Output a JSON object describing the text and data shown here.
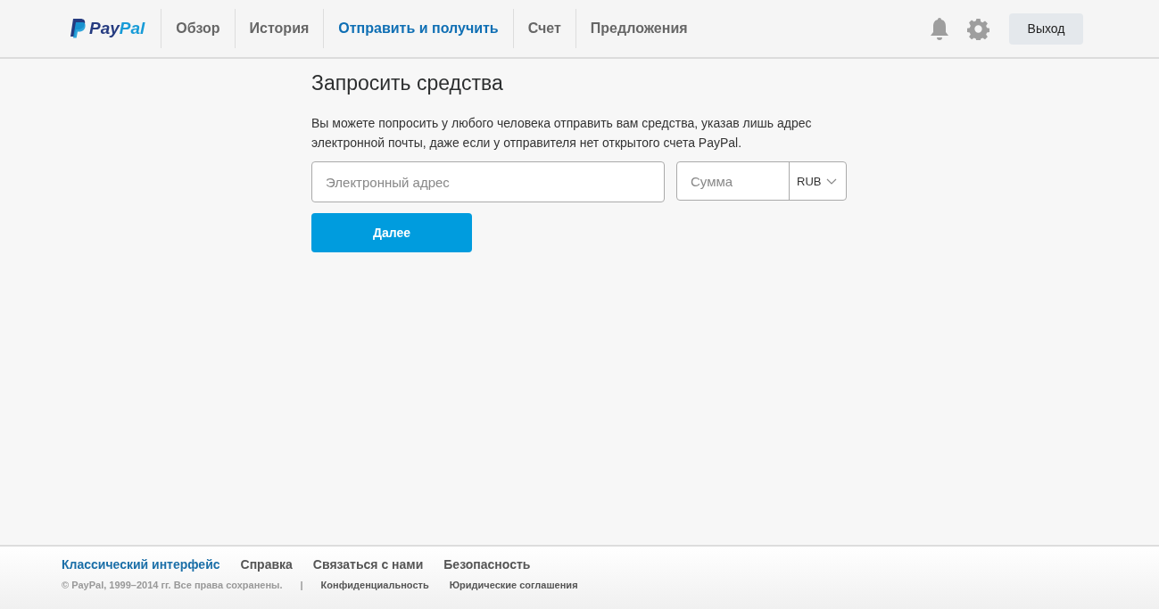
{
  "logo": {
    "parts": [
      "Pay",
      "Pal"
    ]
  },
  "nav": [
    {
      "label": "Обзор",
      "selected": false
    },
    {
      "label": "История",
      "selected": false
    },
    {
      "label": "Отправить и получить",
      "selected": true
    },
    {
      "label": "Счет",
      "selected": false
    },
    {
      "label": "Предложения",
      "selected": false
    }
  ],
  "logout_button": "Выход",
  "main": {
    "title": "Запросить средства",
    "description": "Вы можете попросить у любого человека отправить вам средства, указав лишь адрес электронной почты, даже если у отправителя нет открытого счета PayPal.",
    "email_field": {
      "placeholder": "Электронный адрес"
    },
    "amount_field": {
      "placeholder": "Сумма"
    },
    "currency": "RUB",
    "next_button": "Далее"
  },
  "footer": {
    "links": [
      {
        "label": "Классический интерфейс",
        "highlighted": true
      },
      {
        "label": "Справка",
        "highlighted": false
      },
      {
        "label": "Связаться с нами",
        "highlighted": false
      },
      {
        "label": "Безопасность",
        "highlighted": false
      }
    ],
    "copyright": "© PayPal, 1999–2014 гг. Все права сохранены.",
    "separator": "|",
    "legal_links": [
      "Конфиденциальность",
      "Юридические соглашения"
    ]
  }
}
